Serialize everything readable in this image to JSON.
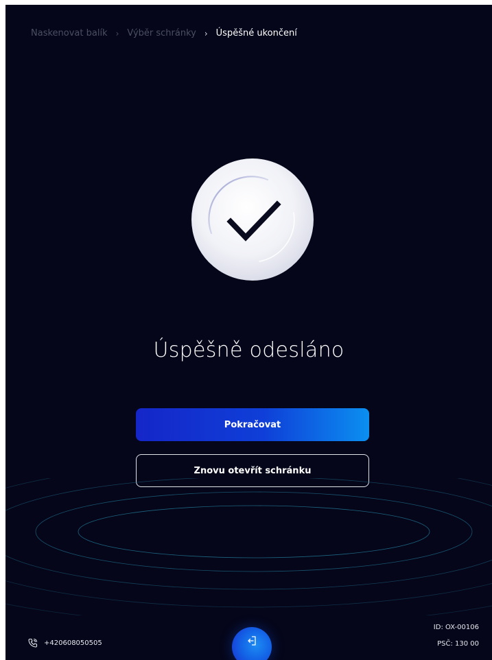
{
  "breadcrumb": {
    "items": [
      "Naskenovat balík",
      "Výběr schránky",
      "Úspěšné ukončení"
    ],
    "separator": "›"
  },
  "status": {
    "title": "Úspěšně odesláno",
    "icon": "checkmark-icon"
  },
  "actions": {
    "continue_label": "Pokračovat",
    "reopen_label": "Znovu otevřít schránku"
  },
  "footer": {
    "phone": "+420608050505",
    "phone_icon": "phone-icon",
    "exit_icon": "logout-icon",
    "device_id": "ID: OX-00106",
    "postal_code": "PSČ: 130 00"
  },
  "colors": {
    "background": "#05061a",
    "primary_gradient_start": "#1526c8",
    "primary_gradient_end": "#0b8ff0",
    "ring": "#1f6f8b"
  }
}
